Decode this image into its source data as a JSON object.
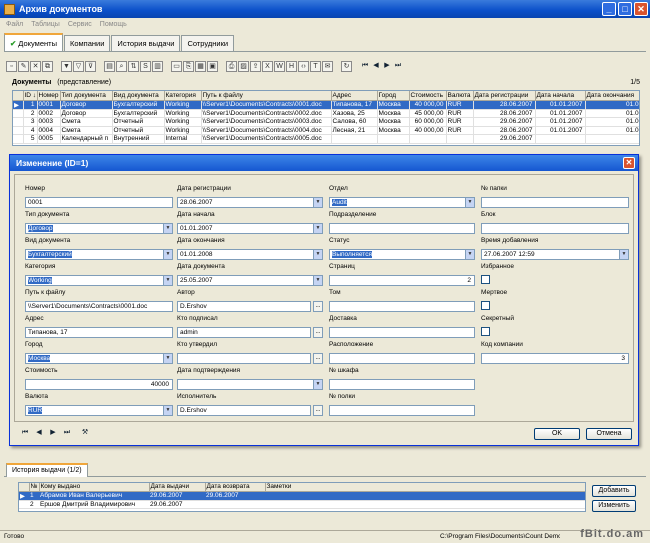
{
  "window": {
    "title": "Архив документов"
  },
  "menu": [
    "Файл",
    "Таблицы",
    "Сервис",
    "Помощь"
  ],
  "tabs": [
    "Документы",
    "Компании",
    "История выдачи",
    "Сотрудники"
  ],
  "grid": {
    "title": "Документы",
    "view": "(представление)",
    "page": "1/5",
    "columns": [
      "ID ↓",
      "Номер",
      "Тип документа",
      "Вид документа",
      "Категория",
      "Путь к файлу",
      "Адрес",
      "Город",
      "Стоимость",
      "Валюта",
      "Дата регистрации",
      "Дата начала",
      "Дата окончания"
    ],
    "rows": [
      [
        "1",
        "0001",
        "Договор",
        "Бухгалтерский",
        "Working",
        "\\\\Server1\\Documents\\Contracts\\0001.doc",
        "Типанова, 17",
        "Москва",
        "40 000,00",
        "RUR",
        "28.06.2007",
        "01.01.2007",
        "01.01.2008"
      ],
      [
        "2",
        "0002",
        "Договор",
        "Бухгалтерский",
        "Working",
        "\\\\Server1\\Documents\\Contracts\\0002.doc",
        "Хазова, 25",
        "Москва",
        "45 000,00",
        "RUR",
        "28.06.2007",
        "01.01.2007",
        "01.01.2008"
      ],
      [
        "3",
        "0003",
        "Смета",
        "Отчетный",
        "Working",
        "\\\\Server1\\Documents\\Contracts\\0003.doc",
        "Салова, 60",
        "Москва",
        "60 000,00",
        "RUR",
        "29.06.2007",
        "01.01.2007",
        "01.01.2008"
      ],
      [
        "4",
        "0004",
        "Смета",
        "Отчетный",
        "Working",
        "\\\\Server1\\Documents\\Contracts\\0004.doc",
        "Лесная, 21",
        "Москва",
        "40 000,00",
        "RUR",
        "28.06.2007",
        "01.01.2007",
        "01.01.2008"
      ],
      [
        "5",
        "0005",
        "Календарный п",
        "Внутренний",
        "Internal",
        "\\\\Server1\\Documents\\Contracts\\0005.doc",
        "",
        "",
        "",
        "",
        "29.06.2007",
        "",
        ""
      ]
    ]
  },
  "dialog": {
    "title": "Изменение (ID=1)",
    "fields": {
      "nomer": {
        "label": "Номер",
        "value": "0001"
      },
      "tip": {
        "label": "Тип документа",
        "value": "Договор"
      },
      "vid": {
        "label": "Вид документа",
        "value": "Бухгалтерский"
      },
      "kategoriya": {
        "label": "Категория",
        "value": "Working"
      },
      "put": {
        "label": "Путь к файлу",
        "value": "\\\\Server1\\Documents\\Contracts\\0001.doc"
      },
      "adres": {
        "label": "Адрес",
        "value": "Типанова, 17"
      },
      "gorod": {
        "label": "Город",
        "value": "Москва"
      },
      "stoimost": {
        "label": "Стоимость",
        "value": "40000"
      },
      "valyuta": {
        "label": "Валюта",
        "value": "RUR"
      },
      "data_reg": {
        "label": "Дата регистрации",
        "value": "28.06.2007"
      },
      "data_nach": {
        "label": "Дата начала",
        "value": "01.01.2007"
      },
      "data_okon": {
        "label": "Дата окончания",
        "value": "01.01.2008"
      },
      "data_doc": {
        "label": "Дата документа",
        "value": "25.05.2007"
      },
      "avtor": {
        "label": "Автор",
        "value": "D.Ershov"
      },
      "podpisal": {
        "label": "Кто подписал",
        "value": "admin"
      },
      "utverdil": {
        "label": "Кто утвердил",
        "value": ""
      },
      "data_utv": {
        "label": "Дата подтверждения",
        "value": ""
      },
      "ispolnitel": {
        "label": "Исполнитель",
        "value": "D.Ershov"
      },
      "otdel": {
        "label": "Отдел",
        "value": "Audit"
      },
      "podrazd": {
        "label": "Подразделение",
        "value": ""
      },
      "status": {
        "label": "Статус",
        "value": "Выполняется"
      },
      "stranic": {
        "label": "Страниц",
        "value": "2"
      },
      "tom": {
        "label": "Том",
        "value": ""
      },
      "dostavka": {
        "label": "Доставка",
        "value": ""
      },
      "raspol": {
        "label": "Расположение",
        "value": ""
      },
      "shkaf": {
        "label": "№ шкафа",
        "value": ""
      },
      "polka": {
        "label": "№ полки",
        "value": ""
      },
      "papka": {
        "label": "№ папки",
        "value": ""
      },
      "blok": {
        "label": "Блок",
        "value": ""
      },
      "vremya": {
        "label": "Время добавления",
        "value": "27.06.2007 12:59"
      },
      "izbrannoe": {
        "label": "Избранное"
      },
      "mertvoe": {
        "label": "Мертвое"
      },
      "sekretnyi": {
        "label": "Секретный"
      },
      "kod": {
        "label": "Код компании",
        "value": "3"
      }
    },
    "ok_label": "OK",
    "cancel_label": "Отмена"
  },
  "history": {
    "tab": "История выдачи (1/2)",
    "columns": [
      "№",
      "Кому выдано",
      "Дата выдачи",
      "Дата возврата",
      "Заметки"
    ],
    "rows": [
      [
        "1",
        "Абрамов Иван Валерьевич",
        "29.06.2007",
        "29.06.2007",
        ""
      ],
      [
        "2",
        "Ершов Дмитрий Владимирович",
        "29.06.2007",
        "",
        ""
      ]
    ],
    "add_label": "Добавить",
    "edit_label": "Изменить"
  },
  "status": {
    "left": "Готово",
    "path": "C:\\Program Files\\Documents\\Count Demo\\data"
  },
  "watermark": "fBit.do.am"
}
